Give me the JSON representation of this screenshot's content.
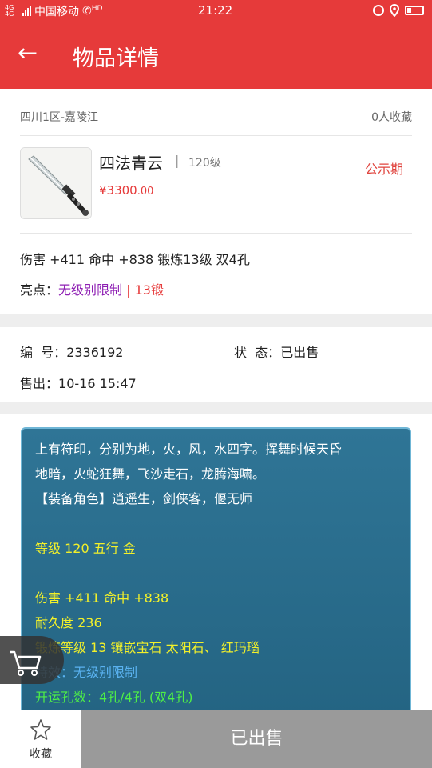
{
  "status_bar": {
    "network": "4G 4G",
    "carrier": "中国移动",
    "hd": "HD",
    "time": "21:22"
  },
  "appbar": {
    "back": "←",
    "title": "物品详情"
  },
  "item": {
    "server": "四川1区-嘉陵江",
    "favorites": "0人收藏",
    "name": "四法青云",
    "separator": "|",
    "level": "120级",
    "price": "¥3300",
    "price_decimals": ".00",
    "period": "公示期",
    "stats": "伤害 +411 命中 +838 锻炼13级 双4孔",
    "highlight_label": "亮点：",
    "highlight_1": "无级别限制",
    "highlight_sep": " | ",
    "highlight_2": "13锻"
  },
  "info": {
    "id_label": "编  号：",
    "id_value": "2336192",
    "status_label": "状  态：",
    "status_value": "已出售",
    "sold_label": "售出：",
    "sold_value": "10-16 15:47"
  },
  "description": {
    "l1": "上有符印，分别为地，火，风，水四字。挥舞时候天昏",
    "l2": "地暗，火蛇狂舞，飞沙走石，龙腾海啸。",
    "l3": "【装备角色】逍遥生，剑侠客，偃无师",
    "l4": "等级 120 五行 金",
    "l5": "伤害 +411 命中 +838",
    "l6": "耐久度 236",
    "l7": "锻炼等级 13 镶嵌宝石 太阳石、 红玛瑙",
    "l8": "特效：无级别限制",
    "l9": "开运孔数：4孔/4孔 (双4孔)"
  },
  "bottom": {
    "favorite_label": "收藏",
    "sold_label": "已出售"
  }
}
